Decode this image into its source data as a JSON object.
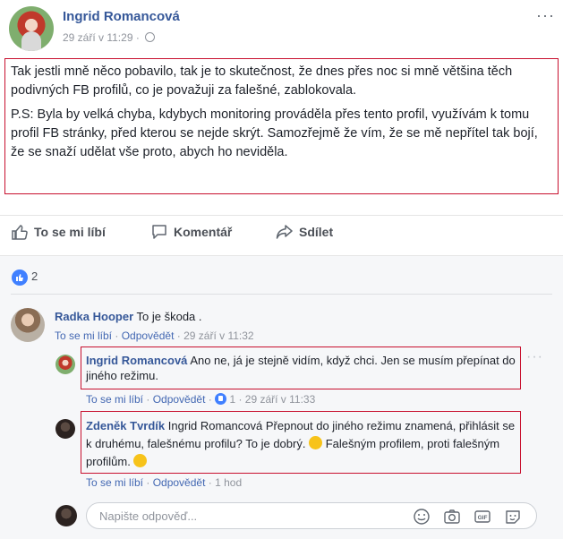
{
  "post": {
    "author": "Ingrid Romancová",
    "timestamp": "29 září v 11:29 ·",
    "paragraph1": "Tak jestli mně něco pobavilo, tak je to skutečnost, že dnes přes noc si mně většina těch podivných FB profilů, co je považuji za falešné, zablokovala.",
    "paragraph2": "P.S: Byla by velká chyba, kdybych monitoring prováděla přes tento profil, využívám k tomu profil FB stránky, před kterou se nejde skrýt. Samozřejmě že vím, že se mě nepřítel tak bojí, že se snaží udělat vše proto, abych ho neviděla.",
    "more": "···"
  },
  "actions": {
    "like": "To se mi líbí",
    "comment": "Komentář",
    "share": "Sdílet"
  },
  "reactions": {
    "count": "2"
  },
  "comments": [
    {
      "author": "Radka Hooper",
      "text": " To je škoda .",
      "like": "To se mi líbí",
      "reply": "Odpovědět",
      "time": " · 29 září v 11:32"
    },
    {
      "author": "Ingrid Romancová",
      "text": " Ano ne, já je stejně vidím, když chci. Jen se musím přepínat do jiného režimu.",
      "like": "To se mi líbí",
      "reply": "Odpovědět",
      "likes": "1",
      "time": " · 29 září v 11:33",
      "more": "···"
    },
    {
      "author": "Zdeněk Tvrdík",
      "text_a": " Ingrid Romancová Přepnout do jiného režimu znamená, přihlásit se k druhému, falešnému profilu? To je dobrý. ",
      "text_b": " Falešným profilem, proti falešným profilům. ",
      "like": "To se mi líbí",
      "reply": "Odpovědět",
      "time": " · 1 hod"
    }
  ],
  "reply_input": {
    "placeholder": "Napište odpověď..."
  },
  "colors": {
    "link": "#365899",
    "highlight": "#c8102e",
    "like_blue": "#4080ff"
  }
}
